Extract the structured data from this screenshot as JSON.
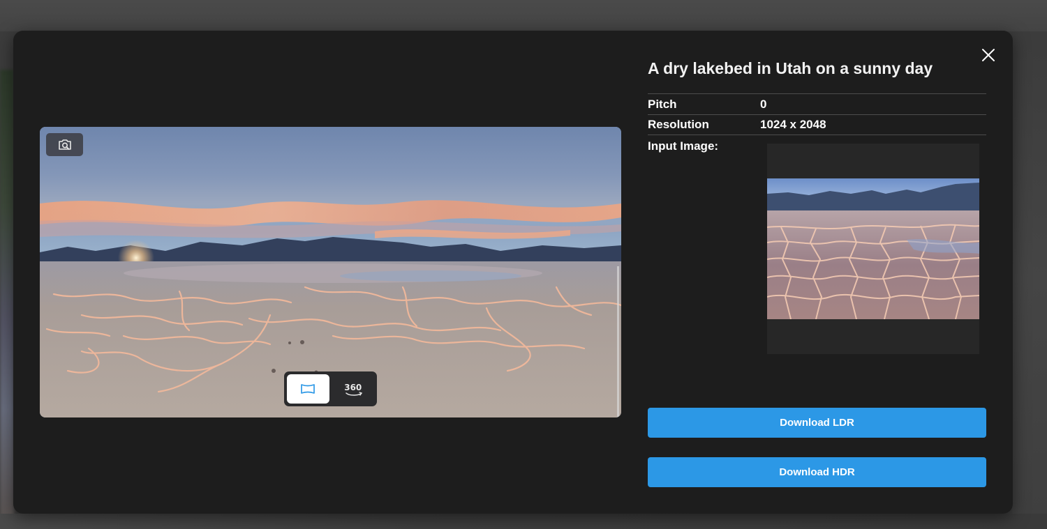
{
  "modal": {
    "title": "A dry lakebed in Utah on a sunny day",
    "details": [
      {
        "key": "Pitch",
        "value": "0"
      },
      {
        "key": "Resolution",
        "value": "1024 x 2048"
      }
    ],
    "input_image_label": "Input Image:",
    "buttons": {
      "download_ldr": "Download LDR",
      "download_hdr": "Download HDR"
    }
  },
  "viewer": {
    "toggle": {
      "options": [
        "flat-view",
        "360-view"
      ],
      "active": "flat-view",
      "label_360": "360"
    }
  },
  "icons": {
    "close": "close-icon",
    "zoom": "camera-search-icon",
    "flat_view": "panorama-icon",
    "view_360": "360-icon"
  },
  "colors": {
    "modal_bg": "#1d1d1d",
    "accent_button": "#2c98e6",
    "text": "#ffffff"
  }
}
